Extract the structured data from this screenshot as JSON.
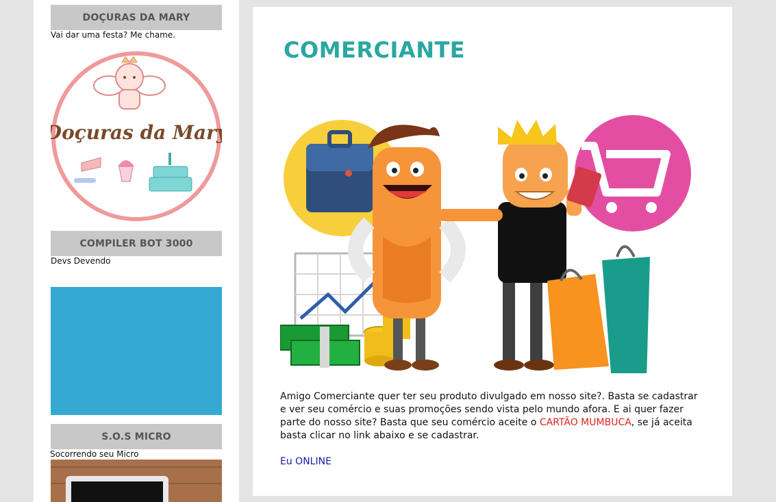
{
  "sidebar": {
    "cards": [
      {
        "title": "DOÇURAS DA MARY",
        "description": "Vai dar uma festa? Me chame.",
        "image_text": "Doçuras da Mary"
      },
      {
        "title": "COMPILER BOT 3000",
        "description": "Devs Devendo"
      },
      {
        "title": "S.O.S MICRO",
        "description": "Socorrendo seu Micro"
      }
    ]
  },
  "main": {
    "title": "COMERCIANTE",
    "paragraph": {
      "before": "Amigo Comerciante quer ter seu produto divulgado em nosso site?. Basta se cadastrar e ver seu comércio e suas promoções sendo vista pelo mundo afora. E ai quer fazer parte do nosso site? Basta que seu comércio aceite o ",
      "highlight": "CARTÃO MUMBUCA",
      "after": ", se já aceita basta clicar no link abaixo e se cadastrar."
    },
    "link_label": "Eu ONLINE"
  },
  "colors": {
    "background": "#e4e4e4",
    "title": "#2aa7a1",
    "highlight": "#dd2222",
    "link": "#1a1aa8",
    "card_header": "#c8c8c8",
    "compiler_tile": "#36a9d2"
  }
}
